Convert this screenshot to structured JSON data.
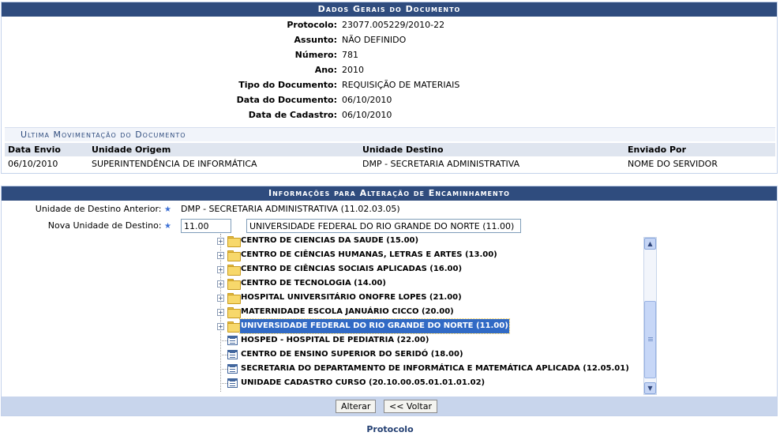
{
  "general": {
    "title": "Dados Gerais do Documento",
    "fields": [
      {
        "label": "Protocolo:",
        "value": "23077.005229/2010-22"
      },
      {
        "label": "Assunto:",
        "value": "NÃO DEFINIDO"
      },
      {
        "label": "Número:",
        "value": "781"
      },
      {
        "label": "Ano:",
        "value": "2010"
      },
      {
        "label": "Tipo do Documento:",
        "value": "REQUISIÇÃO DE MATERIAIS"
      },
      {
        "label": "Data do Documento:",
        "value": "06/10/2010"
      },
      {
        "label": "Data de Cadastro:",
        "value": "06/10/2010"
      }
    ]
  },
  "movement": {
    "title": "Ultima Movimentação do Documento",
    "headers": [
      "Data Envio",
      "Unidade Origem",
      "Unidade Destino",
      "Enviado Por"
    ],
    "row": [
      "06/10/2010",
      "SUPERINTENDÊNCIA DE INFORMÁTICA",
      "DMP - SECRETARIA ADMINISTRATIVA",
      "NOME DO SERVIDOR"
    ]
  },
  "change": {
    "title": "Informações para Alteração de Encaminhamento",
    "prev_label": "Unidade de Destino Anterior:",
    "prev_value": "DMP - SECRETARIA ADMINISTRATIVA (11.02.03.05)",
    "new_label": "Nova Unidade de Destino:",
    "code_value": "11.00",
    "name_value": "UNIVERSIDADE FEDERAL DO RIO GRANDE DO NORTE (11.00)",
    "tree": [
      {
        "label": "CENTRO DE CIENCIAS DA SAUDE (15.00)",
        "kind": "folder"
      },
      {
        "label": "CENTRO DE CIÊNCIAS HUMANAS, LETRAS E ARTES (13.00)",
        "kind": "folder"
      },
      {
        "label": "CENTRO DE CIÊNCIAS SOCIAIS APLICADAS (16.00)",
        "kind": "folder"
      },
      {
        "label": "CENTRO DE TECNOLOGIA (14.00)",
        "kind": "folder"
      },
      {
        "label": "HOSPITAL UNIVERSITÁRIO ONOFRE LOPES (21.00)",
        "kind": "folder"
      },
      {
        "label": "MATERNIDADE ESCOLA JANUÁRIO CICCO (20.00)",
        "kind": "folder"
      },
      {
        "label": "UNIVERSIDADE FEDERAL DO RIO GRANDE DO NORTE (11.00)",
        "kind": "folder",
        "selected": true
      },
      {
        "label": "HOSPED - HOSPITAL DE PEDIATRIA (22.00)",
        "kind": "leaf"
      },
      {
        "label": "CENTRO DE ENSINO SUPERIOR DO SERIDÓ (18.00)",
        "kind": "leaf"
      },
      {
        "label": "SECRETARIA DO DEPARTAMENTO DE INFORMÁTICA E MATEMÁTICA APLICADA (12.05.01)",
        "kind": "leaf"
      },
      {
        "label": "UNIDADE CADASTRO CURSO (20.10.00.05.01.01.01.02)",
        "kind": "leaf"
      }
    ],
    "alter_label": "Alterar",
    "back_label": "<< Voltar"
  },
  "footer": {
    "link": "Protocolo"
  },
  "icons": {
    "expand": "plus-box-icon",
    "folder": "folder-icon",
    "leaf": "document-icon",
    "required": "star-icon"
  }
}
